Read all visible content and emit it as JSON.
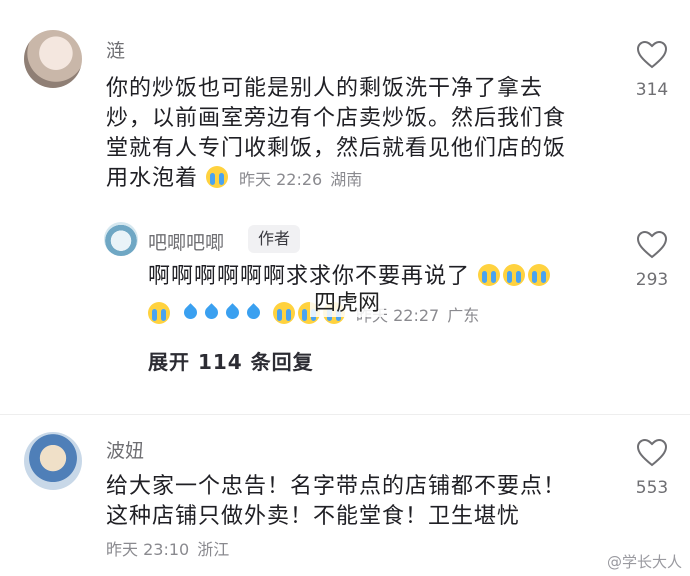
{
  "comments": [
    {
      "username": "涟",
      "lines": [
        "你的炒饭也可能是别人的剩饭洗干净了拿去",
        "炒，以前画室旁边有个店卖炒饭。然后我们食",
        "堂就有人专门收剩饭，然后就看见他们店的饭",
        "用水泡着"
      ],
      "time": "昨天 22:26",
      "location": "湖南",
      "likes": "314"
    },
    {
      "username": "吧唧吧唧",
      "badge": "作者",
      "line1": "啊啊啊啊啊啊求求你不要再说了",
      "time": "昨天 22:27",
      "location": "广东",
      "likes": "293"
    },
    {
      "username": "波妞",
      "lines": [
        "给大家一个忠告！名字带点的店铺都不要点！",
        "这种店铺只做外卖！不能堂食！卫生堪忧"
      ],
      "time": "昨天 23:10",
      "location": "浙江",
      "likes": "553"
    }
  ],
  "expand_label": "展开 114 条回复",
  "watermark_center": "四虎网",
  "watermark_corner": "@学长大人",
  "icons": {
    "like": "heart-outline-icon",
    "cry": "crying-face-emoji",
    "drop": "water-drop-emoji"
  }
}
